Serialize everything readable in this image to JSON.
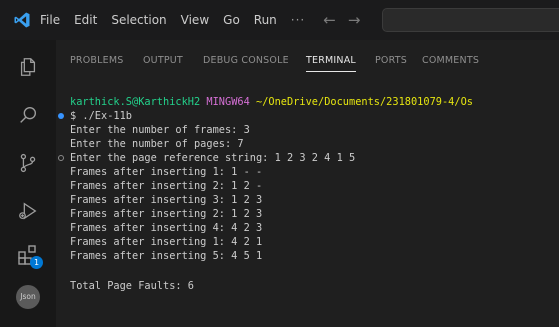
{
  "app": {
    "accent": "#007acc"
  },
  "menu": {
    "file": "File",
    "edit": "Edit",
    "selection": "Selection",
    "view": "View",
    "go": "Go",
    "run": "Run",
    "more": "···",
    "back": "←",
    "forward": "→"
  },
  "activity": [
    {
      "icon": "explorer-icon"
    },
    {
      "icon": "search-icon"
    },
    {
      "icon": "source-control-icon"
    },
    {
      "icon": "run-debug-icon"
    },
    {
      "icon": "extensions-icon",
      "badge": "1"
    },
    {
      "icon": "json-icon",
      "label": "Json"
    }
  ],
  "panel": {
    "tabs": [
      "PROBLEMS",
      "OUTPUT",
      "DEBUG CONSOLE",
      "TERMINAL",
      "PORTS",
      "COMMENTS"
    ],
    "active_tab": "TERMINAL"
  },
  "terminal": {
    "prompt_user": "karthick.S@KarthickH2",
    "prompt_shell": "MINGW64",
    "prompt_path": "~/OneDrive/Documents/231801079-4/Os",
    "command_prefix": "$ ",
    "command": "./Ex-11b",
    "lines": [
      "Enter the number of frames: 3",
      "Enter the number of pages: 7",
      "Enter the page reference string: 1 2 3 2 4 1 5",
      "Frames after inserting 1: 1 - -",
      "Frames after inserting 2: 1 2 -",
      "Frames after inserting 3: 1 2 3",
      "Frames after inserting 2: 1 2 3",
      "Frames after inserting 4: 4 2 3",
      "Frames after inserting 1: 4 2 1",
      "Frames after inserting 5: 4 5 1",
      "",
      "Total Page Faults: 6"
    ]
  }
}
